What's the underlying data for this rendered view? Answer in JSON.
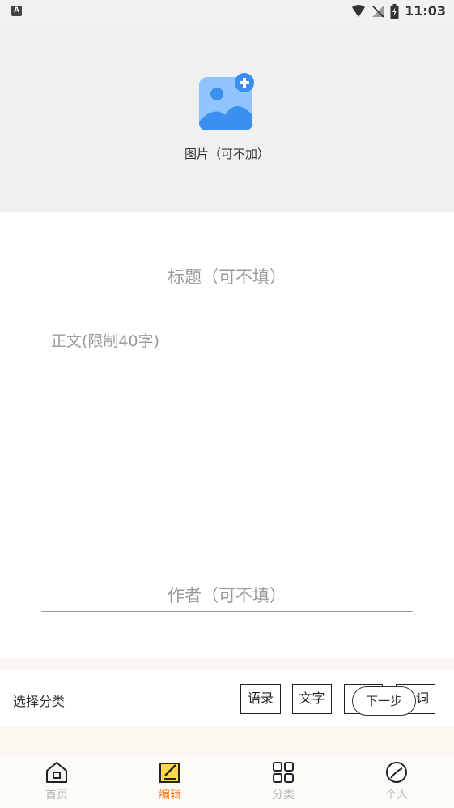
{
  "status_bar": {
    "left_badge": "A",
    "time": "11:03"
  },
  "image_picker": {
    "caption": "图片（可不加）",
    "icon": "add-image-icon"
  },
  "form": {
    "title_placeholder": "标题（可不填）",
    "body_placeholder": "正文(限制40字)",
    "author_placeholder": "作者（可不填）"
  },
  "category": {
    "label": "选择分类",
    "options": [
      "语录",
      "文字",
      "",
      "词"
    ],
    "next_label": "下一步"
  },
  "bottom_nav": {
    "items": [
      {
        "label": "首页",
        "icon": "home-icon",
        "active": false
      },
      {
        "label": "编辑",
        "icon": "edit-icon",
        "active": true
      },
      {
        "label": "分类",
        "icon": "grid-icon",
        "active": false
      },
      {
        "label": "个人",
        "icon": "profile-icon",
        "active": false
      }
    ]
  },
  "colors": {
    "accent": "#f07f2a",
    "image_blue": "#3b8ff0",
    "image_light_blue": "#8fc4ff"
  }
}
